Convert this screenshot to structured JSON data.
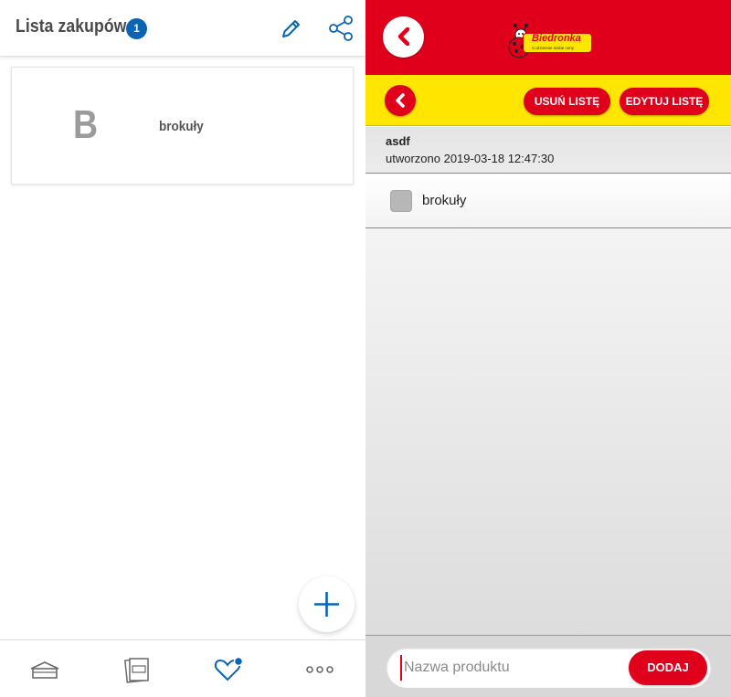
{
  "left": {
    "header": {
      "title": "Lista zakupów",
      "badge_count": "1",
      "edit_icon": "pencil-icon",
      "share_icon": "share-icon"
    },
    "items": [
      {
        "letter": "B",
        "name": "brokuły"
      }
    ],
    "fab_icon": "plus-icon",
    "bottom_nav": [
      {
        "icon": "home-icon"
      },
      {
        "icon": "leaflet-icon"
      },
      {
        "icon": "heart-icon",
        "has_dot": true
      },
      {
        "icon": "more-icon"
      }
    ],
    "colors": {
      "accent": "#0a63b3"
    }
  },
  "right": {
    "header": {
      "back_icon": "chevron-left-icon",
      "logo_text": "Biedronka",
      "logo_tagline": "Codziennie niskie ceny"
    },
    "toolbar": {
      "back_icon": "chevron-left-icon",
      "remove_list_label": "USUŃ LISTĘ",
      "edit_list_label": "EDYTUJ LISTĘ"
    },
    "list": {
      "name": "asdf",
      "created": "utworzono 2019-03-18 12:47:30"
    },
    "items": [
      {
        "name": "brokuły",
        "checked": false
      }
    ],
    "add_bar": {
      "placeholder": "Nazwa produktu",
      "add_label": "DODAJ"
    },
    "colors": {
      "red": "#e0001b",
      "yellow": "#ffe600"
    }
  }
}
